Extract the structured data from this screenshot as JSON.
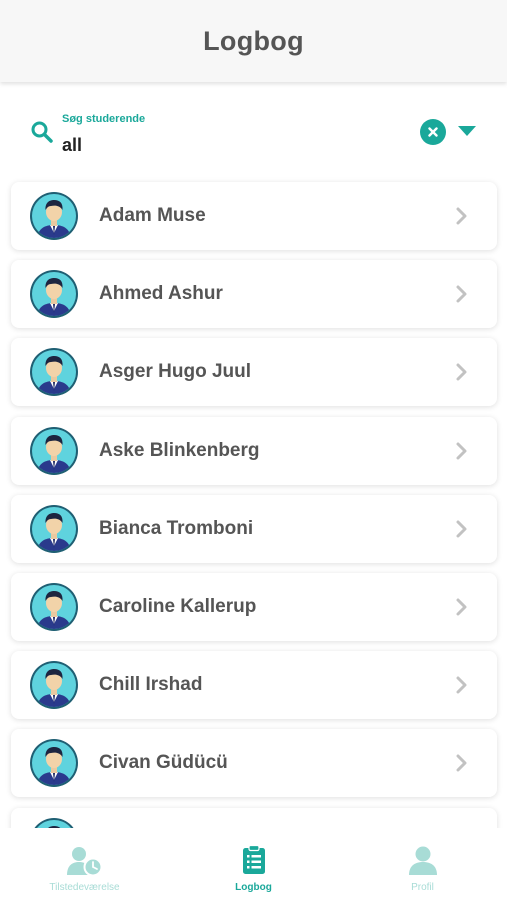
{
  "header": {
    "title": "Logbog"
  },
  "search": {
    "label": "Søg studerende",
    "value": "all"
  },
  "students": [
    {
      "name": "Adam Muse"
    },
    {
      "name": "Ahmed Ashur"
    },
    {
      "name": "Asger Hugo Juul"
    },
    {
      "name": "Aske Blinkenberg"
    },
    {
      "name": "Bianca Tromboni"
    },
    {
      "name": "Caroline Kallerup"
    },
    {
      "name": "Chill Irshad"
    },
    {
      "name": "Civan Güdücü"
    }
  ],
  "tabs": [
    {
      "label": "Tilstedeværelse",
      "icon": "attendance-icon",
      "active": false
    },
    {
      "label": "Logbog",
      "icon": "clipboard-icon",
      "active": true
    },
    {
      "label": "Profil",
      "icon": "profile-icon",
      "active": false
    }
  ],
  "colors": {
    "accent": "#1aa89a",
    "inactive": "#a8dcd6",
    "avatar_bg": "#5fd3de"
  }
}
